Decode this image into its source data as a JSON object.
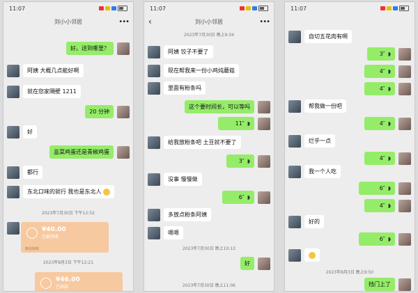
{
  "p1": {
    "status_time": "11:07",
    "title": "刘小小邻居",
    "msgs": {
      "m1": "好。送到哪里？",
      "m2": "阿姨 大概几点能好啊",
      "m3": "就在您家隔壁 1211",
      "m4": "20 分钟",
      "m5": "好",
      "m6": "韭菜鸡蛋还是青椒鸡蛋",
      "m7": "都行",
      "m8": "东北口味的就行 我也是东北人",
      "t1": "2023年7月30日 下午12:52",
      "tf1_amt": "¥40.00",
      "tf1_sub": "已被领收",
      "tf1_foot": "微信转账",
      "t2": "2023年8月3日 下午12:21",
      "tf2_amt": "¥46.00",
      "tf2_sub": "已收款"
    }
  },
  "p2": {
    "status_time": "11:07",
    "title": "刘小小邻居",
    "msgs": {
      "t0": "2023年7月30日 晚上9:34",
      "m1": "阿姨 饺子不要了",
      "m2": "现在帮我来一份小鸡炖蘑菇",
      "m3": "里面有粉条吗",
      "m4": "这个要时间长，可以等吗",
      "m5": "11″",
      "m6": "给我放粉条吧 土豆就不要了",
      "m7": "3″",
      "m8": "没事 慢慢做",
      "m9": "6″",
      "m10": "多放点粉条阿姨",
      "m11": "嗯嗯",
      "t1": "2023年7月30日 晚上10:13",
      "m12": "好",
      "t2": "2023年7月30日 晚上11:06"
    }
  },
  "p3": {
    "status_time": "11:07",
    "msgs": {
      "m1": "自切五花肉有啊",
      "m2": "3″",
      "m3": "4″",
      "m4": "4″",
      "m5": "帮我做一份吧",
      "m6": "4″",
      "m7": "烂乎一点",
      "m8": "4″",
      "m9": "我一个人吃",
      "m10": "6″",
      "m11": "4″",
      "m12": "好的",
      "m13": "6″",
      "t1": "2023年8月3日 晚上9:50",
      "m14": "挡门上了"
    }
  }
}
